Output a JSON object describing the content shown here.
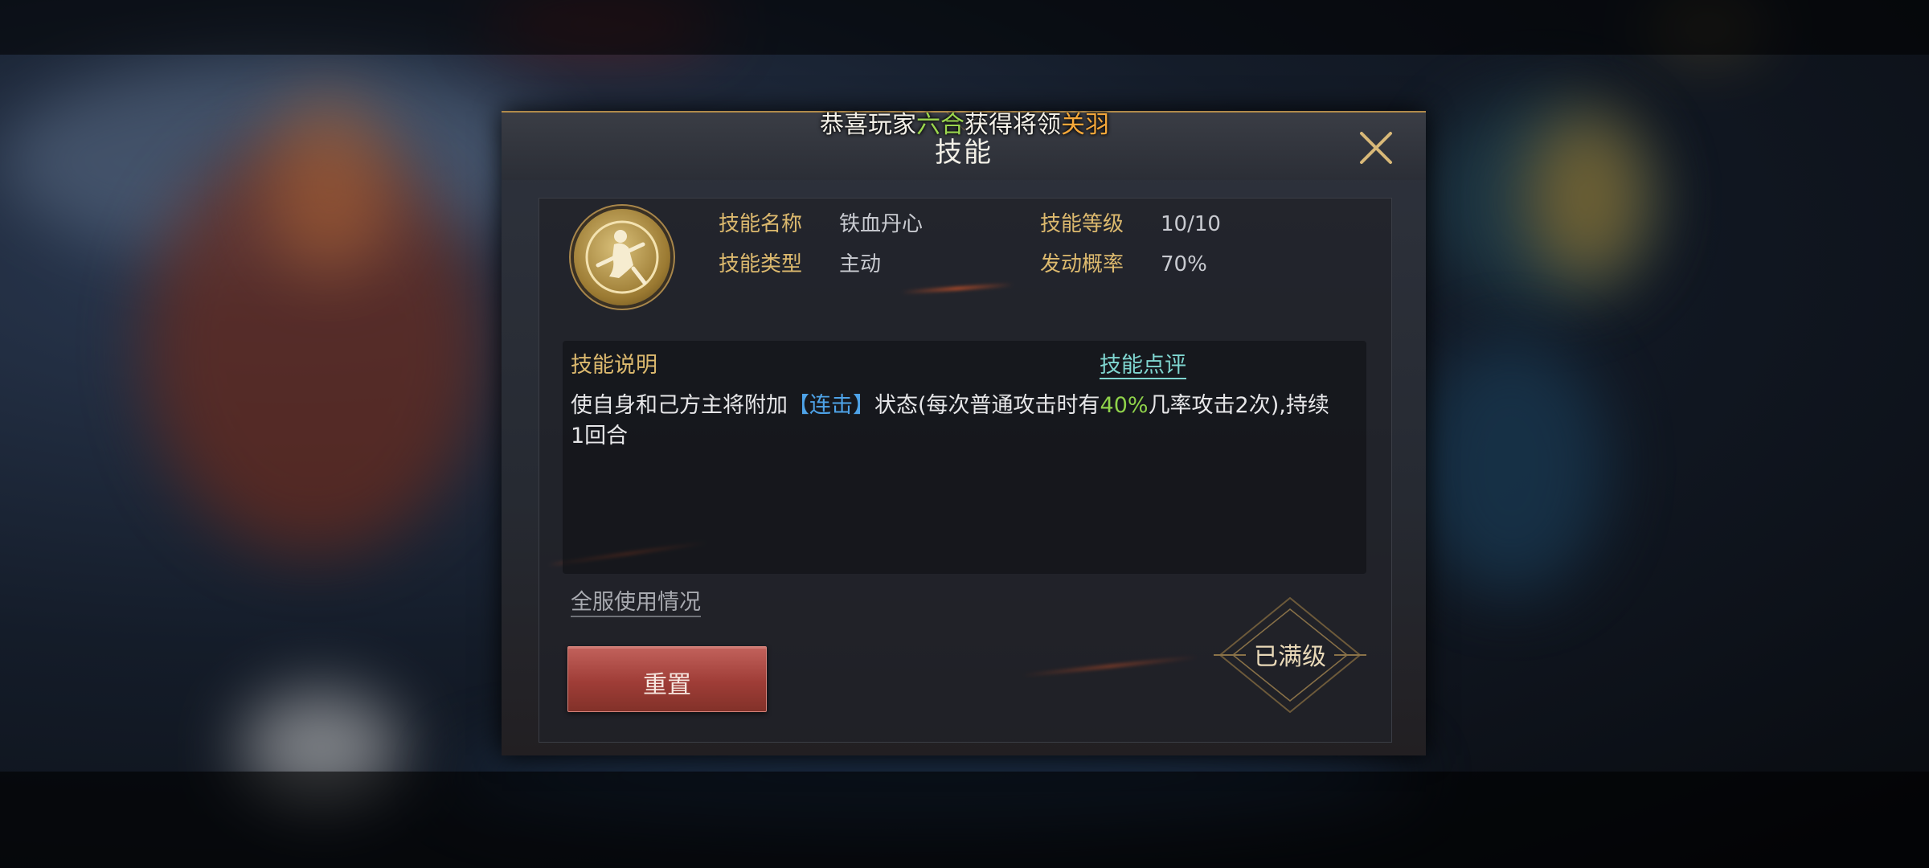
{
  "announcement": {
    "prefix": "恭喜玩家",
    "player": "六合",
    "middle": "获得将领",
    "general": "关羽"
  },
  "dialog": {
    "title": "技能",
    "close_icon": "close-x-icon"
  },
  "skill": {
    "icon": "skill-emblem-icon",
    "name_label": "技能名称",
    "name_value": "铁血丹心",
    "level_label": "技能等级",
    "level_value": "10/10",
    "type_label": "技能类型",
    "type_value": "主动",
    "chance_label": "发动概率",
    "chance_value": "70%"
  },
  "description": {
    "title": "技能说明",
    "review_link": "技能点评",
    "text_1": "使自身和己方主将附加",
    "keyword": "【连击】",
    "text_2": "状态(每次普通攻击时有",
    "percent": "40%",
    "text_3": "几率攻击2次),持续1回合"
  },
  "footer": {
    "usage_link": "全服使用情况",
    "reset_button": "重置",
    "maxed_label": "已满级"
  },
  "colors": {
    "gold_label": "#dcb96e",
    "keyword_blue": "#4ea3e8",
    "percent_green": "#8fd24a",
    "link_teal": "#7fd6d0",
    "reset_red": "#9f3d37",
    "announce_green": "#9bd64e",
    "announce_orange": "#f4a73a"
  }
}
